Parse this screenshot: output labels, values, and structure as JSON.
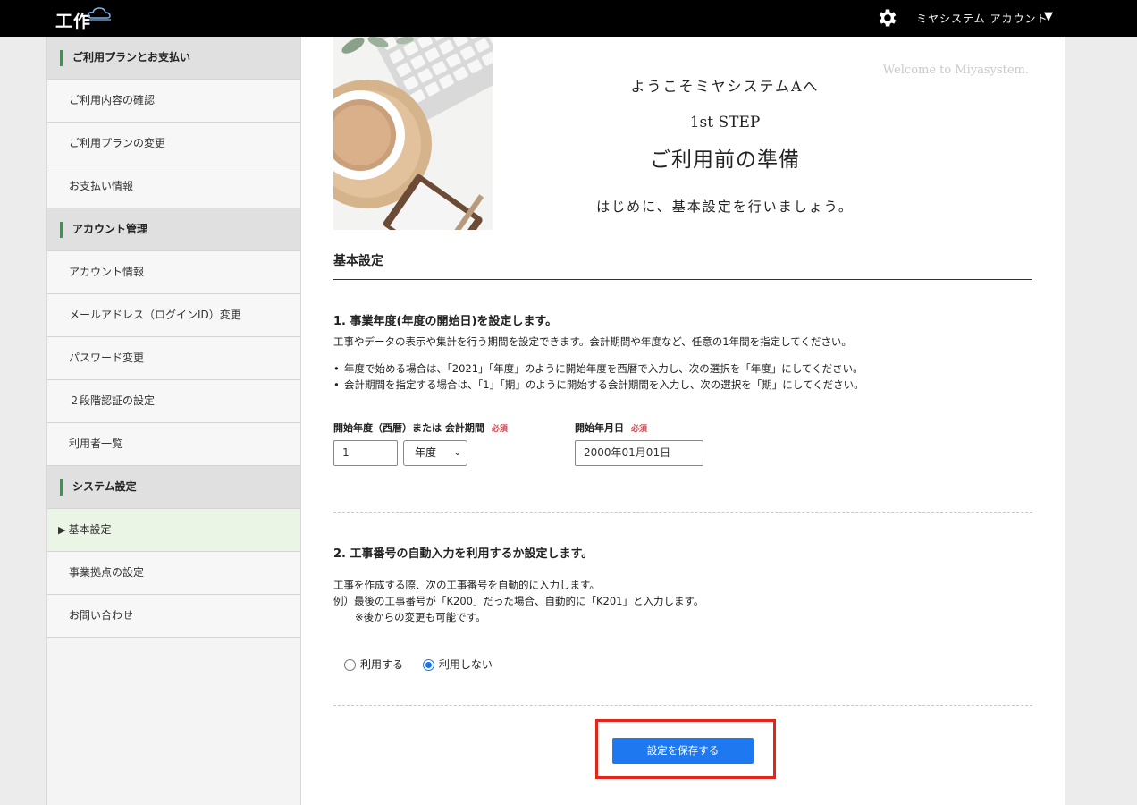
{
  "header": {
    "logo_text": "工作",
    "account_label": "ミヤシステム アカウント",
    "account_caret": "▼"
  },
  "sidebar": {
    "items": [
      {
        "label": "ご利用プランとお支払い",
        "type": "heading"
      },
      {
        "label": "ご利用内容の確認",
        "type": "link"
      },
      {
        "label": "ご利用プランの変更",
        "type": "link"
      },
      {
        "label": "お支払い情報",
        "type": "link"
      },
      {
        "label": "アカウント管理",
        "type": "heading"
      },
      {
        "label": "アカウント情報",
        "type": "link"
      },
      {
        "label": "メールアドレス（ログインID）変更",
        "type": "link"
      },
      {
        "label": "パスワード変更",
        "type": "link"
      },
      {
        "label": "２段階認証の設定",
        "type": "link"
      },
      {
        "label": "利用者一覧",
        "type": "link"
      },
      {
        "label": "システム設定",
        "type": "heading"
      },
      {
        "label": "基本設定",
        "type": "active"
      },
      {
        "label": "事業拠点の設定",
        "type": "link"
      },
      {
        "label": "お問い合わせ",
        "type": "link"
      }
    ],
    "active_marker": "▶"
  },
  "banner": {
    "welcome": "Welcome to Miyasystem.",
    "line1": "ようこそミヤシステムAへ",
    "line2": "1st STEP",
    "line3": "ご利用前の準備",
    "line4": "はじめに、基本設定を行いましょう。"
  },
  "main": {
    "section_title": "基本設定",
    "q1": {
      "title": "1. 事業年度(年度の開始日)を設定します。",
      "desc": "工事やデータの表示や集計を行う期間を設定できます。会計期間や年度など、任意の1年間を指定してください。",
      "bullets": [
        "年度で始める場合は、「2021」「年度」のように開始年度を西暦で入力し、次の選択を「年度」にしてください。",
        "会計期間を指定する場合は、「1」「期」のように開始する会計期間を入力し、次の選択を「期」にしてください。"
      ],
      "field1_label": "開始年度（西暦）または 会計期間",
      "field1_value": "1",
      "field1_unit": "年度",
      "field2_label": "開始年月日",
      "field2_value": "2000年01月01日",
      "required": "必須"
    },
    "q2": {
      "title": "2. 工事番号の自動入力を利用するか設定します。",
      "desc1": "工事を作成する際、次の工事番号を自動的に入力します。",
      "desc2": "例）最後の工事番号が「K200」だった場合、自動的に「K201」と入力します。",
      "desc3": "※後からの変更も可能です。",
      "option_use": "利用する",
      "option_not_use": "利用しない",
      "selected": "利用しない"
    },
    "save_label": "設定を保存する"
  },
  "colors": {
    "accent": "#1e78f0",
    "sidebar_marker": "#2e9e44",
    "required": "#e0404a",
    "highlight": "#e0251b"
  }
}
